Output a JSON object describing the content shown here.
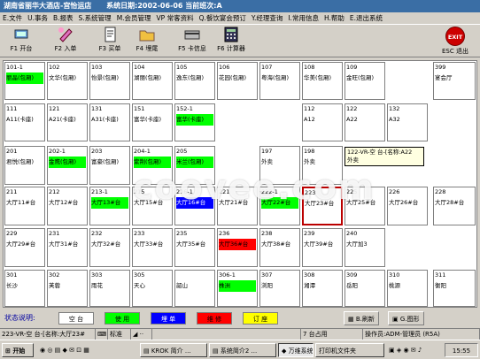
{
  "window": {
    "title_hotel": "湖南省丽华大酒店-宫怡运店",
    "title_system_date": "系统日期:2002-06-06",
    "title_shift": "当前班次:A"
  },
  "menu": [
    "E.文件",
    "U.事务",
    "B.报表",
    "S.系统管理",
    "M.会员管理",
    "VP 常客资料",
    "Q.餐饮宴会预订",
    "Y.经理查询",
    "I.常用信息",
    "H.帮助",
    "E.退出系统"
  ],
  "toolbar": {
    "open": "F1 开台",
    "order": "F2 入单",
    "checkout": "F3 买单",
    "tail": "F4 埋尾",
    "card": "F5 卡信息",
    "calc": "F6 计算器",
    "exit": "ESC 退出",
    "exit_icon_text": "EXIT"
  },
  "colors": {
    "empty": "#ffffff",
    "in_use": "#00ff00",
    "ordered": "#0000ff",
    "repair": "#ff0000",
    "reserved": "#ffff00"
  },
  "tables": [
    {
      "no": "101-1",
      "name": "丽晶(包厢)",
      "status": "in_use"
    },
    {
      "no": "102",
      "name": "文华(包厢)",
      "status": "empty"
    },
    {
      "no": "103",
      "name": "怡景(包厢)",
      "status": "empty"
    },
    {
      "no": "104",
      "name": "湖丽(包厢)",
      "status": "empty"
    },
    {
      "no": "105",
      "name": "逸东(包厢)",
      "status": "empty"
    },
    {
      "no": "106",
      "name": "花园(包厢)",
      "status": "empty"
    },
    {
      "no": "107",
      "name": "粤海(包厢)",
      "status": "empty"
    },
    {
      "no": "108",
      "name": "华美(包厢)",
      "status": "empty"
    },
    {
      "no": "109",
      "name": "金旺(包厢)",
      "status": "empty"
    },
    {
      "no": "",
      "name": "",
      "status": "empty"
    },
    {
      "no": "399",
      "name": "宴会厅",
      "status": "empty"
    },
    {
      "no": "111",
      "name": "A11(卡座)",
      "status": "empty"
    },
    {
      "no": "121",
      "name": "A21(卡座)",
      "status": "empty"
    },
    {
      "no": "131",
      "name": "A31(卡座)",
      "status": "empty"
    },
    {
      "no": "151",
      "name": "富华(卡座)",
      "status": "empty"
    },
    {
      "no": "152-1",
      "name": "富华(卡座)",
      "status": "in_use"
    },
    {
      "no": "",
      "name": "",
      "status": "empty"
    },
    {
      "no": "",
      "name": "",
      "status": "empty"
    },
    {
      "no": "112",
      "name": "A12",
      "status": "empty"
    },
    {
      "no": "122",
      "name": "A22",
      "status": "empty"
    },
    {
      "no": "132",
      "name": "A32",
      "status": "empty"
    },
    {
      "no": "",
      "name": "",
      "status": "empty"
    },
    {
      "no": "201",
      "name": "君悦(包厢)",
      "status": "empty"
    },
    {
      "no": "202-1",
      "name": "金鹰(包厢)",
      "status": "in_use"
    },
    {
      "no": "203",
      "name": "富豪(包厢)",
      "status": "empty"
    },
    {
      "no": "204-1",
      "name": "紫荆(包厢)",
      "status": "in_use"
    },
    {
      "no": "205",
      "name": "米兰(包厢)",
      "status": "in_use"
    },
    {
      "no": "",
      "name": "",
      "status": "empty"
    },
    {
      "no": "197",
      "name": "外卖",
      "status": "empty"
    },
    {
      "no": "198",
      "name": "外卖",
      "status": "empty"
    },
    {
      "no": "",
      "name": "",
      "status": "empty"
    },
    {
      "no": "",
      "name": "",
      "status": "empty"
    },
    {
      "no": "",
      "name": "",
      "status": "empty"
    },
    {
      "no": "211",
      "name": "大厅11#台",
      "status": "empty"
    },
    {
      "no": "212",
      "name": "大厅12#台",
      "status": "empty"
    },
    {
      "no": "213-1",
      "name": "大厅13#台",
      "status": "in_use"
    },
    {
      "no": "215",
      "name": "大厅15#台",
      "status": "empty"
    },
    {
      "no": "216-1",
      "name": "大厅16#台",
      "status": "ordered"
    },
    {
      "no": "221",
      "name": "大厅21#台",
      "status": "empty"
    },
    {
      "no": "222-1",
      "name": "大厅22#台",
      "status": "in_use"
    },
    {
      "no": "223",
      "name": "大厅23#台",
      "status": "empty",
      "selected": true
    },
    {
      "no": "225",
      "name": "大厅25#台",
      "status": "empty"
    },
    {
      "no": "226",
      "name": "大厅26#台",
      "status": "empty"
    },
    {
      "no": "228",
      "name": "大厅28#台",
      "status": "empty"
    },
    {
      "no": "229",
      "name": "大厅29#台",
      "status": "empty"
    },
    {
      "no": "231",
      "name": "大厅31#台",
      "status": "empty"
    },
    {
      "no": "232",
      "name": "大厅32#台",
      "status": "empty"
    },
    {
      "no": "233",
      "name": "大厅33#台",
      "status": "empty"
    },
    {
      "no": "235",
      "name": "大厅35#台",
      "status": "empty"
    },
    {
      "no": "236",
      "name": "大厅36#台",
      "status": "repair"
    },
    {
      "no": "238",
      "name": "大厅38#台",
      "status": "empty"
    },
    {
      "no": "239",
      "name": "大厅39#台",
      "status": "empty"
    },
    {
      "no": "240",
      "name": "大厅加3",
      "status": "empty"
    },
    {
      "no": "",
      "name": "",
      "status": "empty"
    },
    {
      "no": "",
      "name": "",
      "status": "empty"
    },
    {
      "no": "301",
      "name": "长沙",
      "status": "empty"
    },
    {
      "no": "302",
      "name": "芙蓉",
      "status": "empty"
    },
    {
      "no": "303",
      "name": "雨花",
      "status": "empty"
    },
    {
      "no": "305",
      "name": "天心",
      "status": "empty"
    },
    {
      "no": "",
      "name": "韶山",
      "status": "empty"
    },
    {
      "no": "306-1",
      "name": "株洲",
      "status": "in_use"
    },
    {
      "no": "307",
      "name": "浏阳",
      "status": "empty"
    },
    {
      "no": "308",
      "name": "湘潭",
      "status": "empty"
    },
    {
      "no": "309",
      "name": "岳阳",
      "status": "empty"
    },
    {
      "no": "310",
      "name": "桃源",
      "status": "empty"
    },
    {
      "no": "311",
      "name": "衡阳",
      "status": "empty"
    }
  ],
  "tooltip": {
    "line1": "122-VR-空 台-[名称:A22",
    "line2": "外卖"
  },
  "watermark": "coovee.com",
  "status_legend": {
    "title": "状态说明:",
    "empty": "空 台",
    "in_use": "使 用",
    "ordered": "埋 单",
    "repair": "维 修",
    "reserved": "订 座"
  },
  "view_buttons": {
    "refresh": "B.刷新",
    "graphic": "G.图形"
  },
  "infobar": {
    "selected": "223-VR-空 台-[名称:大厅23#",
    "mode": "标准",
    "occupancy": "7 台占用",
    "operator": "操作员:ADM-管理员 (R5A)"
  },
  "taskbar": {
    "start": "开始",
    "items": [
      "KROK 简介 ...",
      "系统简介2 ...",
      "万维系统",
      "打印机文件夹"
    ],
    "clock": "15:55"
  }
}
